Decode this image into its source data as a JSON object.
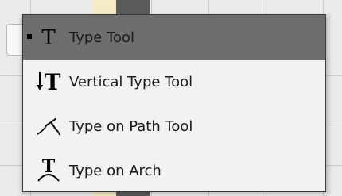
{
  "menu": {
    "items": [
      {
        "label": "Type Tool",
        "icon": "type-tool-icon",
        "selected": true
      },
      {
        "label": "Vertical Type Tool",
        "icon": "vertical-type-tool-icon",
        "selected": false
      },
      {
        "label": "Type on Path Tool",
        "icon": "type-on-path-icon",
        "selected": false
      },
      {
        "label": "Type on Arch",
        "icon": "type-on-arch-icon",
        "selected": false
      }
    ]
  },
  "colors": {
    "selected_bg": "#6e6e6e",
    "menu_bg": "#f2f2f2",
    "menu_border": "#3a3a3a"
  }
}
